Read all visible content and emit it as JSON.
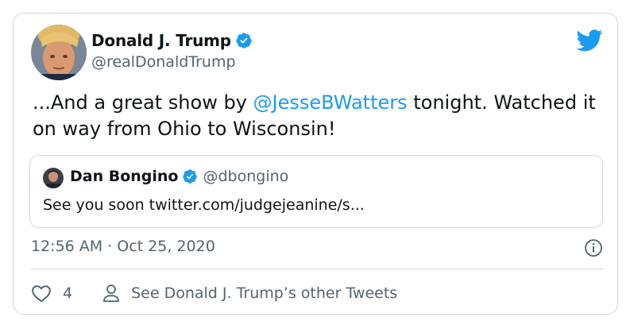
{
  "tweet": {
    "author_name": "Donald J. Trump",
    "author_handle": "@realDonaldTrump",
    "text_part1": "...And a great show by ",
    "mention": "@JesseBWatters",
    "text_part2": " tonight. Watched it on way from Ohio to Wisconsin!",
    "timestamp": "12:56 AM · Oct 25, 2020",
    "like_count": "4",
    "other_tweets_label": "See Donald J. Trump’s other Tweets"
  },
  "quoted": {
    "author_name": "Dan Bongino",
    "author_handle": "@dbongino",
    "text": "See you soon twitter.com/judgejeanine/s..."
  },
  "colors": {
    "accent": "#1d9bf0",
    "secondary_text": "#536471",
    "border": "#cfd9de"
  },
  "icons": {
    "logo": "twitter-bird-icon",
    "verified": "verified-badge-icon",
    "info": "info-icon",
    "like": "heart-icon",
    "profile": "person-icon"
  }
}
